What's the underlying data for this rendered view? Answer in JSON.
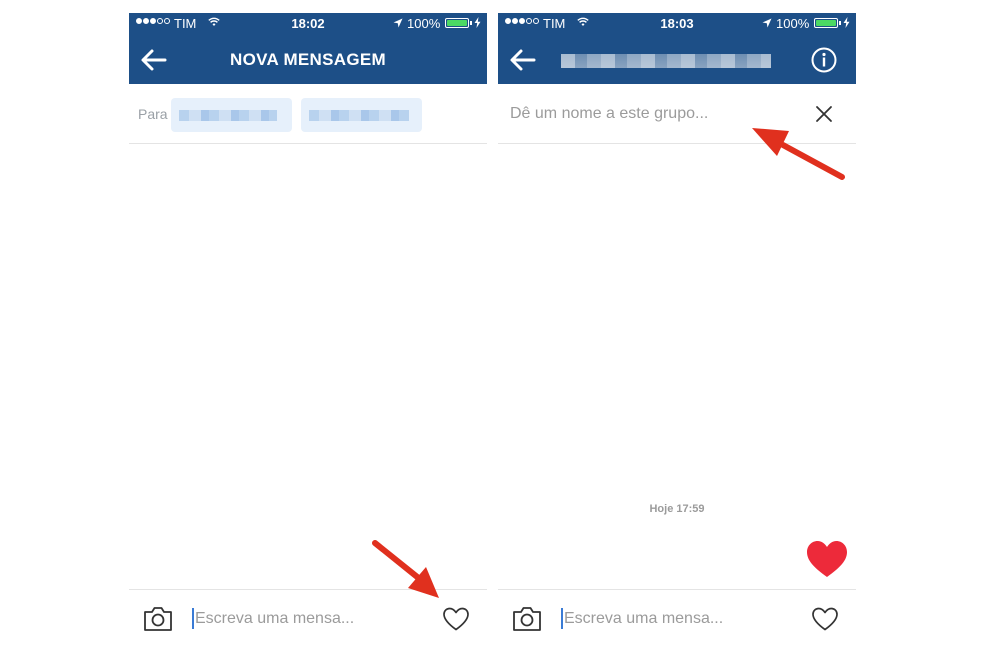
{
  "colors": {
    "header_bg": "#1d4f87",
    "battery_green": "#4cd964",
    "arrow_red": "#e0301e",
    "heart_red": "#ed2a3a",
    "chip_bg": "#e6f0fb"
  },
  "icons": [
    "back-arrow-icon",
    "info-icon",
    "close-icon",
    "camera-icon",
    "heart-icon",
    "wifi-icon",
    "location-icon",
    "battery-icon"
  ],
  "left_screen": {
    "status": {
      "carrier": "TIM",
      "time": "18:02",
      "battery": "100%"
    },
    "header": {
      "title": "NOVA MENSAGEM"
    },
    "to_row": {
      "label": "Para"
    },
    "composer": {
      "placeholder": "Escreva uma mensa..."
    }
  },
  "right_screen": {
    "status": {
      "carrier": "TIM",
      "time": "18:03",
      "battery": "100%"
    },
    "group_name": {
      "placeholder": "Dê um nome a este grupo..."
    },
    "messages": {
      "timestamp": "Hoje 17:59"
    },
    "composer": {
      "placeholder": "Escreva uma mensa..."
    }
  }
}
